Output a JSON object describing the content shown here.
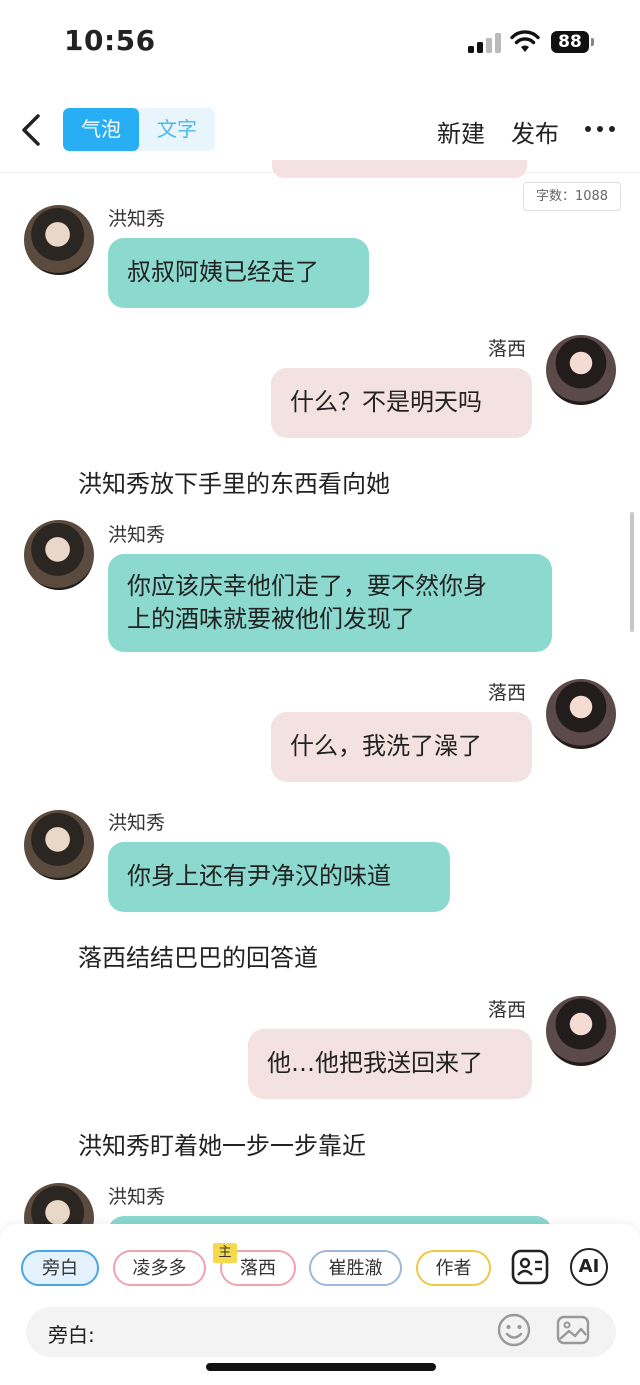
{
  "status_bar": {
    "time": "10:56",
    "battery": "88"
  },
  "nav": {
    "tabs": [
      {
        "label": "气泡",
        "active": true
      },
      {
        "label": "文字",
        "active": false
      }
    ],
    "new_label": "新建",
    "publish_label": "发布"
  },
  "word_count": "字数：1088",
  "messages": [
    {
      "type": "chat",
      "side": "left",
      "name": "洪知秀",
      "lines": [
        "叔叔阿姨已经走了"
      ]
    },
    {
      "type": "chat",
      "side": "right",
      "name": "落西",
      "lines": [
        "什么？不是明天吗"
      ]
    },
    {
      "type": "narration",
      "text": "洪知秀放下手里的东西看向她"
    },
    {
      "type": "chat",
      "side": "left",
      "name": "洪知秀",
      "lines": [
        "你应该庆幸他们走了，要不然你身",
        "上的酒味就要被他们发现了"
      ]
    },
    {
      "type": "chat",
      "side": "right",
      "name": "落西",
      "lines": [
        "什么，我洗了澡了"
      ]
    },
    {
      "type": "chat",
      "side": "left",
      "name": "洪知秀",
      "lines": [
        "你身上还有尹净汉的味道"
      ]
    },
    {
      "type": "narration",
      "text": "落西结结巴巴的回答道"
    },
    {
      "type": "chat",
      "side": "right",
      "name": "落西",
      "lines": [
        "他…他把我送回来了"
      ]
    },
    {
      "type": "narration",
      "text": "洪知秀盯着她一步一步靠近"
    },
    {
      "type": "chat",
      "side": "left",
      "name": "洪知秀",
      "lines": [
        ""
      ]
    }
  ],
  "roles": [
    {
      "label": "旁白",
      "selected": true
    },
    {
      "label": "凌多多"
    },
    {
      "label": "落西",
      "badge": "主"
    },
    {
      "label": "崔胜澈"
    },
    {
      "label": "作者"
    }
  ],
  "tools": {
    "ai_label": "AI"
  },
  "input": {
    "label": "旁白:"
  },
  "colors": {
    "accent": "#28aef5",
    "teal_bubble": "#8bd9cf",
    "pink_bubble": "#f4e1e2"
  }
}
